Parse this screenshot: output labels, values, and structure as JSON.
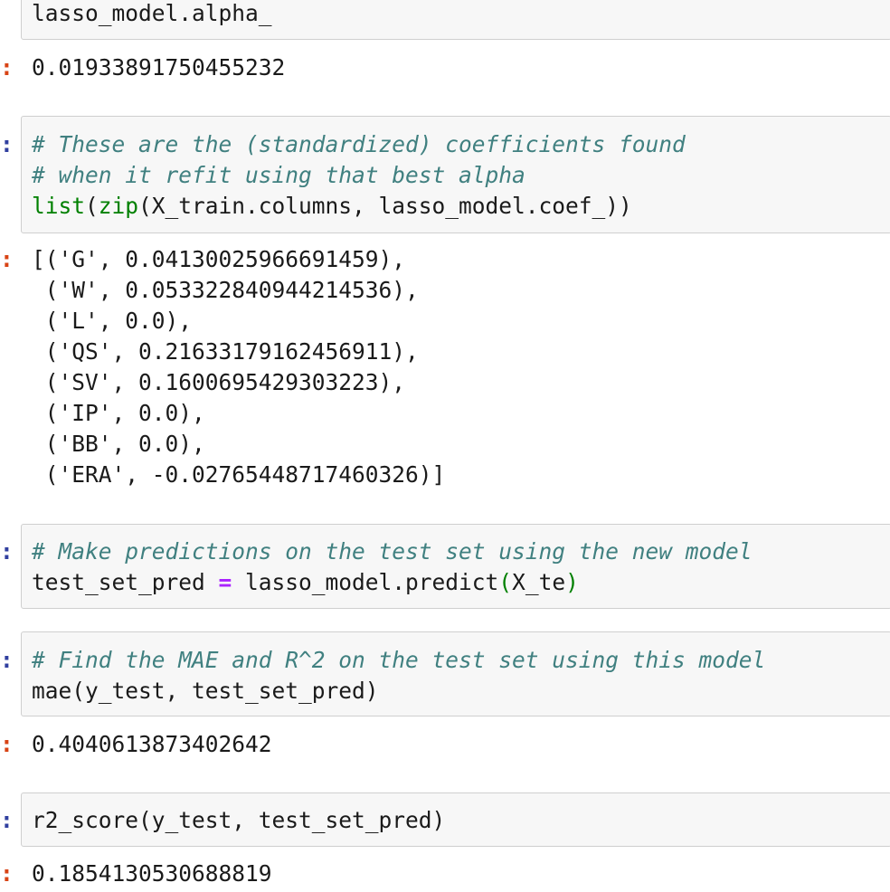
{
  "notebook": {
    "prompt_in": ":",
    "prompt_out": ":",
    "cell1": {
      "code": "lasso_model.alpha_",
      "output": "0.01933891750455232"
    },
    "cell2": {
      "comment1": "# These are the (standardized) coefficients found",
      "comment2": "# when it refit using that best alpha",
      "code_builtin1": "list",
      "code_p1": "(",
      "code_builtin2": "zip",
      "code_rest": "(X_train.columns, lasso_model.coef_))",
      "output": [
        "[('G', 0.04130025966691459),",
        " ('W', 0.05332284094421453 6),",
        " ('L', 0.0),",
        " ('QS', 0.21633179162456911),",
        " ('SV', 0.1600695429303223),",
        " ('IP', 0.0),",
        " ('BB', 0.0),",
        " ('ERA', -0.02765448717460326)]"
      ]
    },
    "cell3": {
      "comment": "# Make predictions on the test set using the new model",
      "code_var": "test_set_pred ",
      "code_op": "=",
      "code_call": " lasso_model.predict",
      "code_paren_open": "(",
      "code_arg": "X_te",
      "code_paren_close": ")"
    },
    "cell4": {
      "comment": "# Find the MAE and R^2 on the test set using this model",
      "code": "mae(y_test, test_set_pred)",
      "output": "0.4040613873402642"
    },
    "cell5": {
      "code": "r2_score(y_test, test_set_pred)",
      "output": "0.1854130530688819"
    }
  }
}
